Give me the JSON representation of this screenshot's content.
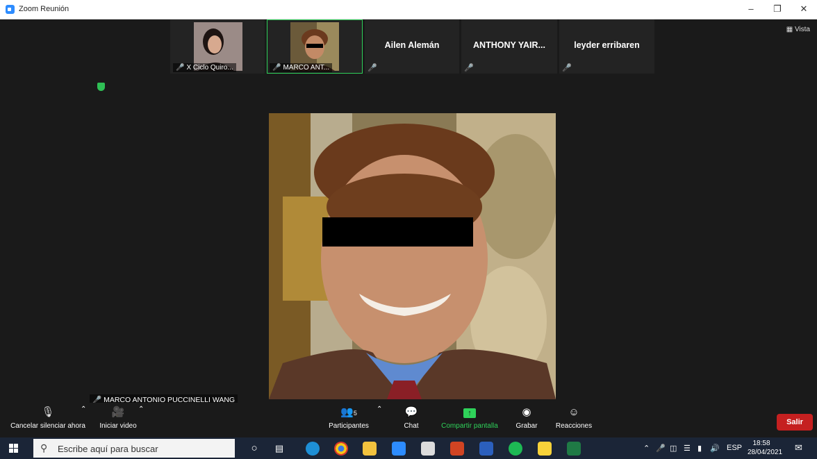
{
  "window": {
    "title": "Zoom Reunión",
    "minimize": "–",
    "maximize": "❐",
    "close": "✕"
  },
  "view_button": "Vista",
  "thumbnails": [
    {
      "name": "X Ciclo Quiro...",
      "has_video": true
    },
    {
      "name": "MARCO ANT...",
      "has_video": true,
      "active": true
    },
    {
      "name": "Ailen Alemán",
      "has_video": false
    },
    {
      "name": "ANTHONY YAIR...",
      "has_video": false
    },
    {
      "name": "leyder erribaren",
      "has_video": false
    }
  ],
  "active_speaker": {
    "name": "MARCO ANTONIO PUCCINELLI WANG"
  },
  "toolbar": {
    "unmute_label": "Cancelar silenciar ahora",
    "start_video_label": "Iniciar video",
    "participants_label": "Participantes",
    "participants_count": "5",
    "chat_label": "Chat",
    "share_screen_label": "Compartir pantalla",
    "record_label": "Grabar",
    "reactions_label": "Reacciones",
    "leave_label": "Salir"
  },
  "colors": {
    "accent_green": "#2fd25a",
    "muted_red": "#e02828",
    "leave_red": "#c52020",
    "taskbar": "#1b2537"
  },
  "taskbar": {
    "search_placeholder": "Escribe aquí para buscar",
    "language": "ESP",
    "time": "18:58",
    "date": "28/04/2021"
  }
}
